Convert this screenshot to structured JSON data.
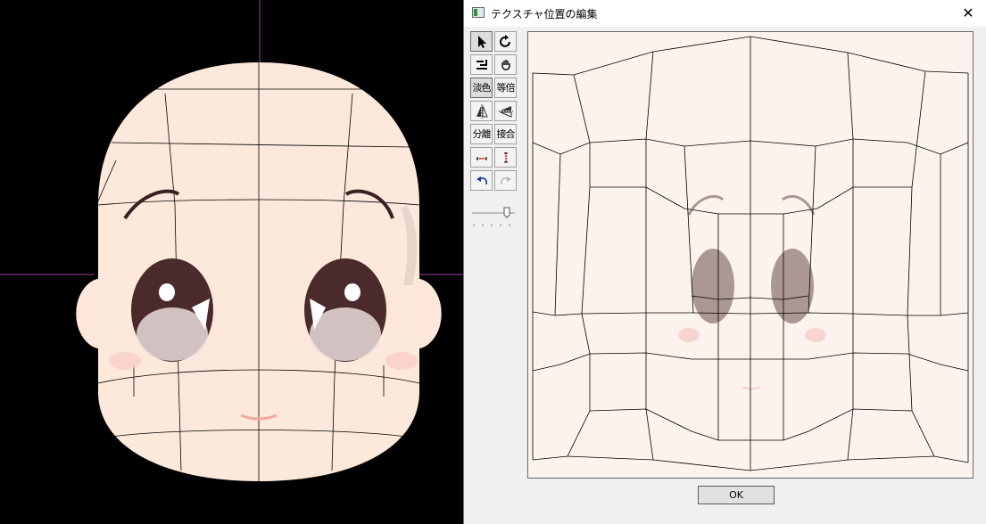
{
  "dialog": {
    "title": "テクスチャ位置の編集",
    "close_label": "✕",
    "ok_label": "OK",
    "toolbar": {
      "select_tool": "select-arrow",
      "rotate_tool": "rotate",
      "scale_tool": "scale",
      "hand_tool": "hand",
      "fade_color_label": "淡色",
      "actual_size_label": "等倍",
      "flip_horizontal": "flip-horizontal",
      "flip_vertical": "flip-vertical",
      "split_label": "分離",
      "join_label": "接合",
      "align_horizontal": "align-horizontal",
      "align_vertical": "align-vertical",
      "undo": "undo",
      "redo": "redo",
      "opacity_slider": "slider"
    }
  },
  "colors": {
    "skin": "#fde9dc",
    "canvas_bg": "#fdf3ee",
    "guide": "#a040a0",
    "eye": "#4a2a2a",
    "blush": "#f8c8c8"
  }
}
